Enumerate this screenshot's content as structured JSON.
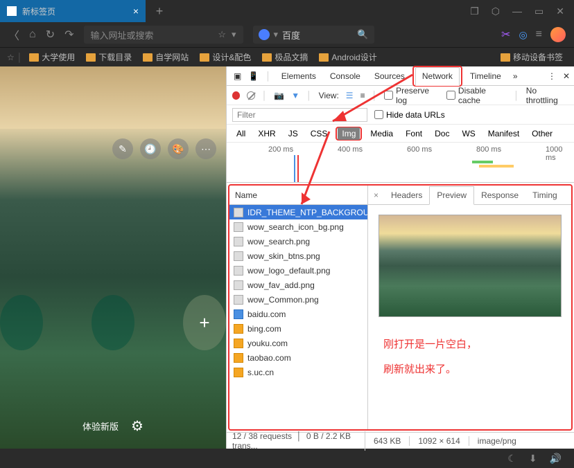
{
  "titlebar": {
    "tab_title": "新标签页"
  },
  "addressbar": {
    "placeholder": "输入网址或搜索",
    "search_engine": "百度"
  },
  "bookmarks": {
    "items": [
      "大学使用",
      "下载目录",
      "自学网站",
      "设计&配色",
      "极品文摘",
      "Android设计"
    ],
    "right": "移动设备书签"
  },
  "ntp": {
    "footer": "体验新版"
  },
  "devtools": {
    "tabs": [
      "Elements",
      "Console",
      "Sources",
      "Network",
      "Timeline"
    ],
    "toolbar": {
      "view": "View:",
      "preserve": "Preserve log",
      "disable": "Disable cache",
      "throttle": "No throttling"
    },
    "filter_placeholder": "Filter",
    "hide_urls": "Hide data URLs",
    "types": [
      "All",
      "XHR",
      "JS",
      "CSS",
      "Img",
      "Media",
      "Font",
      "Doc",
      "WS",
      "Manifest",
      "Other"
    ],
    "waterfall": [
      "200 ms",
      "400 ms",
      "600 ms",
      "800 ms",
      "1000 ms"
    ],
    "name_header": "Name",
    "requests": [
      {
        "name": "IDR_THEME_NTP_BACKGROUN...",
        "ico": "sel"
      },
      {
        "name": "wow_search_icon_bg.png",
        "ico": "gray"
      },
      {
        "name": "wow_search.png",
        "ico": "gray"
      },
      {
        "name": "wow_skin_btns.png",
        "ico": "gray"
      },
      {
        "name": "wow_logo_default.png",
        "ico": "gray"
      },
      {
        "name": "wow_fav_add.png",
        "ico": "gray"
      },
      {
        "name": "wow_Common.png",
        "ico": "gray"
      },
      {
        "name": "baidu.com",
        "ico": "blue"
      },
      {
        "name": "bing.com",
        "ico": "orange"
      },
      {
        "name": "youku.com",
        "ico": "orange"
      },
      {
        "name": "taobao.com",
        "ico": "orange"
      },
      {
        "name": "s.uc.cn",
        "ico": "orange"
      }
    ],
    "preview_tabs": [
      "Headers",
      "Preview",
      "Response",
      "Timing"
    ],
    "annotation_1": "刚打开是一片空白，",
    "annotation_2": "刷新就出来了。",
    "status": {
      "left": "12 / 38 requests",
      "mid": "0 B / 2.2 KB trans...",
      "size": "643 KB",
      "dim": "1092 × 614",
      "type": "image/png"
    }
  }
}
